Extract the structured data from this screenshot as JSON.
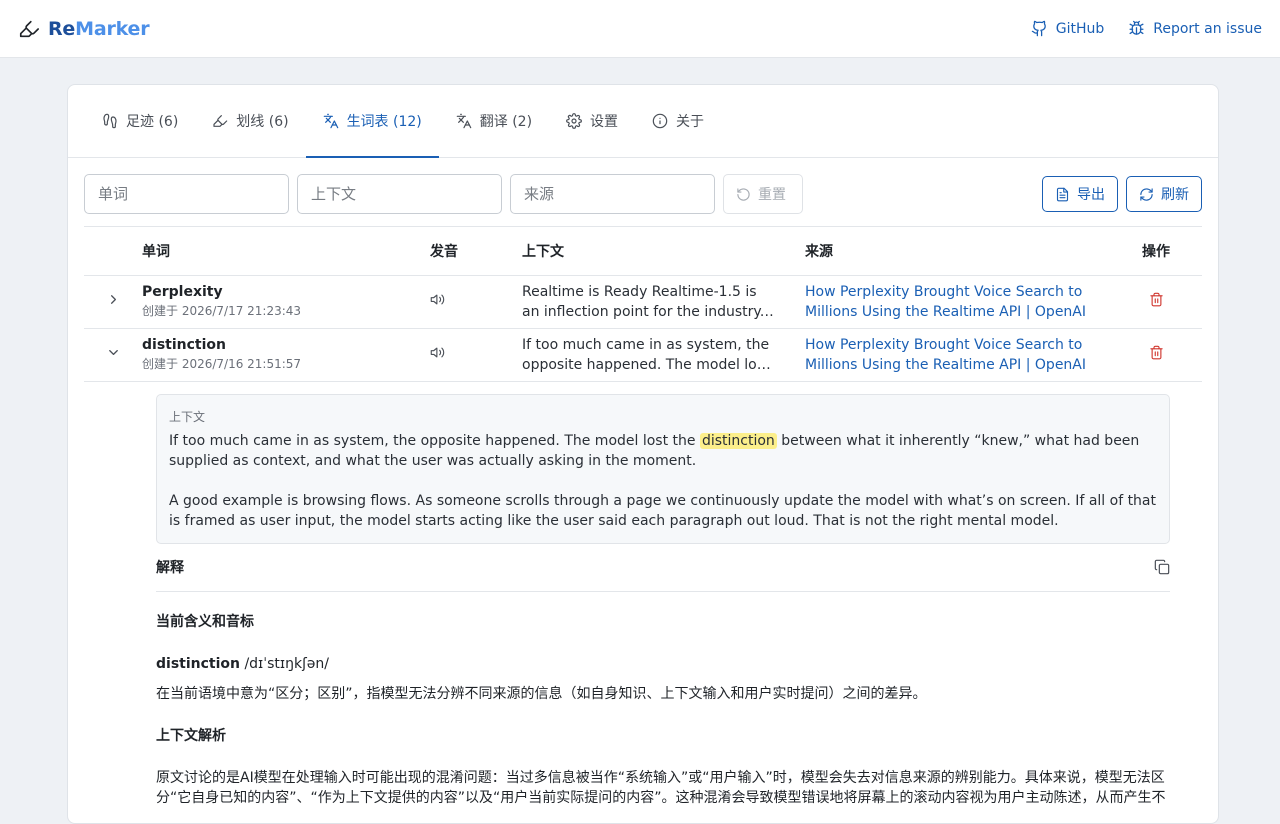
{
  "app": {
    "brand_re": "Re",
    "brand_marker": "Marker"
  },
  "top_links": {
    "github": "GitHub",
    "report": "Report an issue"
  },
  "tabs": [
    {
      "label": "足迹 (6)",
      "icon": "footprint-icon"
    },
    {
      "label": "划线 (6)",
      "icon": "highlighter-icon"
    },
    {
      "label": "生词表 (12)",
      "icon": "translate-icon"
    },
    {
      "label": "翻译 (2)",
      "icon": "language-icon"
    },
    {
      "label": "设置",
      "icon": "gear-icon"
    },
    {
      "label": "关于",
      "icon": "info-icon"
    }
  ],
  "filters": {
    "word_placeholder": "单词",
    "context_placeholder": "上下文",
    "source_placeholder": "来源",
    "reset_label": "重置",
    "export_label": "导出",
    "refresh_label": "刷新"
  },
  "table": {
    "headers": {
      "word": "单词",
      "voice": "发音",
      "context": "上下文",
      "source": "来源",
      "action": "操作"
    },
    "rows": [
      {
        "word": "Perplexity",
        "created": "创建于 2026/7/17 21:23:43",
        "context": "Realtime is Ready Realtime-1.5 is an inflection point for the industry. There is a clear shift happening",
        "source": "How Perplexity Brought Voice Search to Millions Using the Realtime API | OpenAI"
      },
      {
        "word": "distinction",
        "created": "创建于 2026/7/16 21:51:57",
        "context": "If too much came in as system, the opposite happened. The model lost the distinction between",
        "source": "How Perplexity Brought Voice Search to Millions Using the Realtime API | OpenAI"
      }
    ]
  },
  "detail": {
    "context_label": "上下文",
    "para1_before": "If too much came in as system, the opposite happened. The model lost the ",
    "para1_highlight": "distinction",
    "para1_after": " between what it inherently “knew,” what had been supplied as context, and what the user was actually asking in the moment.",
    "para2": "A good example is browsing flows. As someone scrolls through a page we continuously update the model with what’s on screen. If all of that is framed as user input, the model starts acting like the user said each paragraph out loud. That is not the right mental model.",
    "explanation_title": "解释",
    "h_meaning": "当前含义和音标",
    "word": "distinction",
    "phonetic": " /dɪˈstɪŋkʃən/",
    "meaning": "在当前语境中意为“区分；区别”，指模型无法分辨不同来源的信息（如自身知识、上下文输入和用户实时提问）之间的差异。",
    "h_analysis": "上下文解析",
    "analysis": "原文讨论的是AI模型在处理输入时可能出现的混淆问题：当过多信息被当作“系统输入”或“用户输入”时，模型会失去对信息来源的辨别能力。具体来说，模型无法区分“它自身已知的内容”、“作为上下文提供的内容”以及“用户当前实际提问的内容”。这种混淆会导致模型错误地将屏幕上的滚动内容视为用户主动陈述，从而产生不"
  }
}
